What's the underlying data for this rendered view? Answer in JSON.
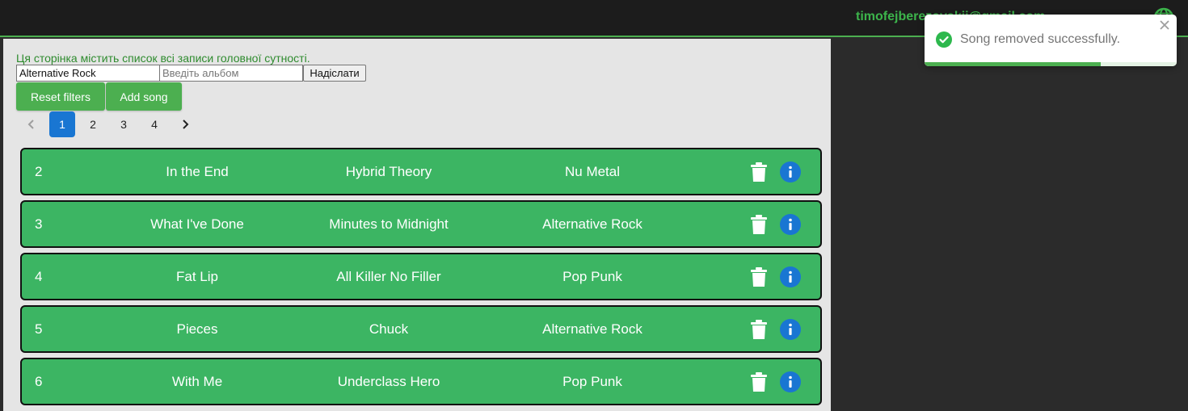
{
  "header": {
    "user_email": "timofejberezovskii@gmail.com",
    "accent_color": "#3cb44b"
  },
  "main": {
    "description": "Ця сторінка містить список всі записи головної сутності.",
    "filters": {
      "genre_value": "Alternative Rock",
      "album_placeholder": "Введіть альбом",
      "submit_label": "Надіслати"
    },
    "buttons": {
      "reset_label": "Reset filters",
      "add_label": "Add song"
    },
    "pagination": {
      "pages": [
        "1",
        "2",
        "3",
        "4"
      ],
      "current": "1"
    },
    "songs": [
      {
        "id": "2",
        "title": "In the End",
        "album": "Hybrid Theory",
        "genre": "Nu Metal"
      },
      {
        "id": "3",
        "title": "What I've Done",
        "album": "Minutes to Midnight",
        "genre": "Alternative Rock"
      },
      {
        "id": "4",
        "title": "Fat Lip",
        "album": "All Killer No Filler",
        "genre": "Pop Punk"
      },
      {
        "id": "5",
        "title": "Pieces",
        "album": "Chuck",
        "genre": "Alternative Rock"
      },
      {
        "id": "6",
        "title": "With Me",
        "album": "Underclass Hero",
        "genre": "Pop Punk"
      }
    ],
    "row_color": "#3cb563",
    "info_icon_color": "#1976d2"
  },
  "toast": {
    "message": "Song removed successfully.",
    "icon": "check-circle-icon",
    "progress": 0.7,
    "color": "#4caf50"
  }
}
